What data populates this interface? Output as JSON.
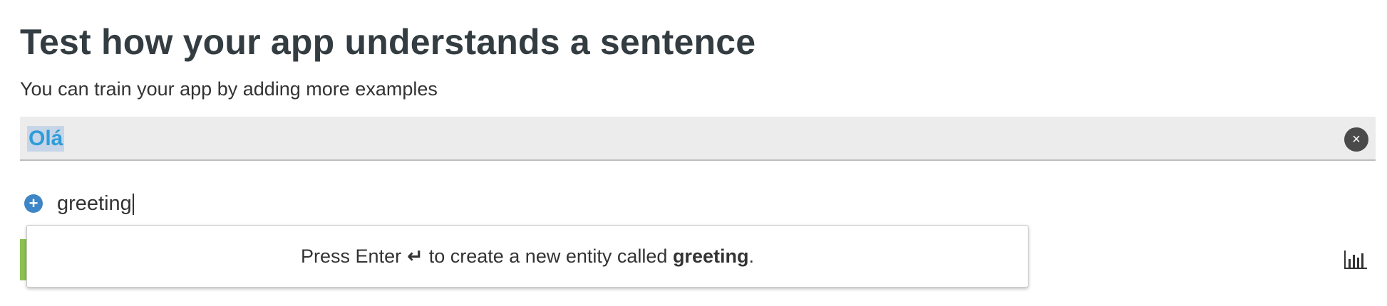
{
  "header": {
    "title": "Test how your app understands a sentence",
    "subtitle": "You can train your app by adding more examples"
  },
  "sentence": {
    "text": "Olá",
    "clear_icon": "×"
  },
  "intent": {
    "add_icon": "+",
    "value": "greeting"
  },
  "dropdown": {
    "prefix": "Press Enter",
    "enter_icon": "↵",
    "middle": "to create a new entity called",
    "entity_name": "greeting",
    "suffix": "."
  },
  "icons": {
    "chart": "bar-chart-icon"
  },
  "colors": {
    "title": "#333c41",
    "selected_text": "#2f9cd8",
    "selection_bg": "#c6d6e8",
    "plus_icon": "#3d85c6",
    "green_bar": "#8cc152"
  }
}
